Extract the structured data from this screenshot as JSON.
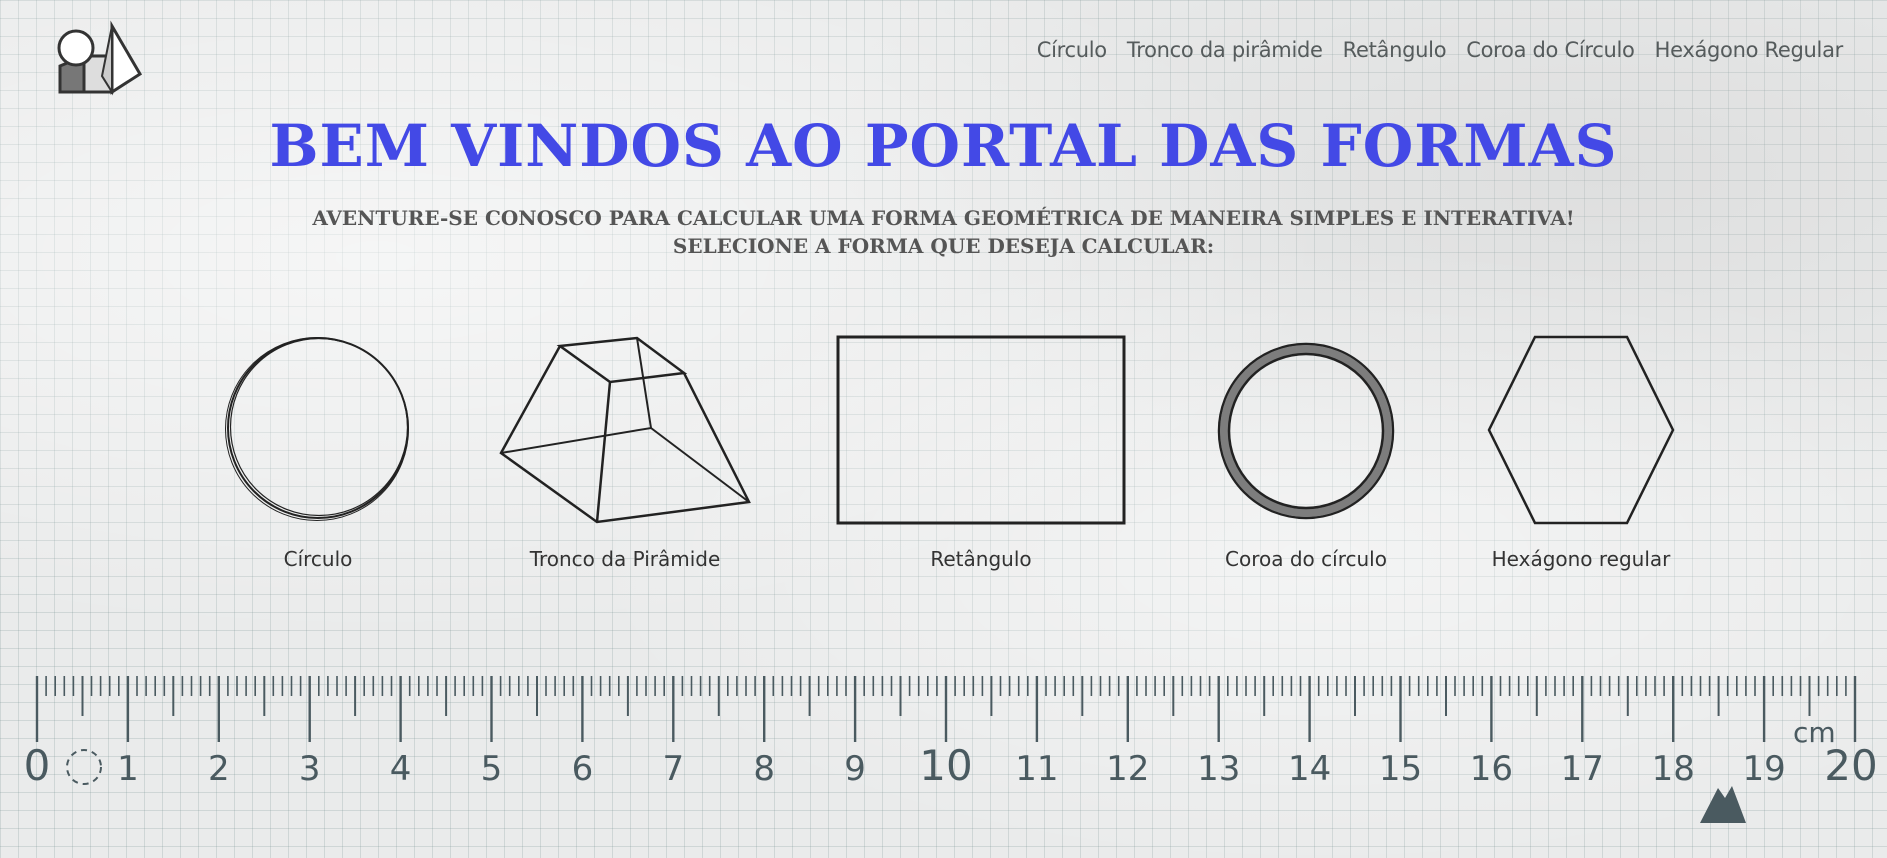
{
  "header": {
    "logo_icon": "geometric-solids-logo-icon",
    "nav": [
      {
        "label": "Círculo"
      },
      {
        "label": "Tronco da pirâmide"
      },
      {
        "label": "Retângulo"
      },
      {
        "label": "Coroa do Círculo"
      },
      {
        "label": "Hexágono Regular"
      }
    ]
  },
  "hero": {
    "title": "BEM VINDOS AO PORTAL DAS FORMAS",
    "subtitle_line1": "Aventure-se conosco para calcular uma forma geométrica de maneira simples e interativa!",
    "subtitle_line2": "Selecione a forma que deseja calcular:"
  },
  "shapes": [
    {
      "label": "Círculo",
      "icon": "circle-icon"
    },
    {
      "label": "Tronco da Pirâmide",
      "icon": "pyramid-frustum-icon"
    },
    {
      "label": "Retângulo",
      "icon": "rectangle-icon"
    },
    {
      "label": "Coroa do círculo",
      "icon": "circle-crown-icon"
    },
    {
      "label": "Hexágono regular",
      "icon": "hexagon-icon"
    }
  ],
  "ruler": {
    "numbers": [
      "0",
      "1",
      "2",
      "3",
      "4",
      "5",
      "6",
      "7",
      "8",
      "9",
      "10",
      "11",
      "12",
      "13",
      "14",
      "15",
      "16",
      "17",
      "18",
      "19",
      "20"
    ],
    "unit": "cm"
  },
  "colors": {
    "title": "#4349e6",
    "ruler": "#4a5a60",
    "text": "#333333"
  }
}
